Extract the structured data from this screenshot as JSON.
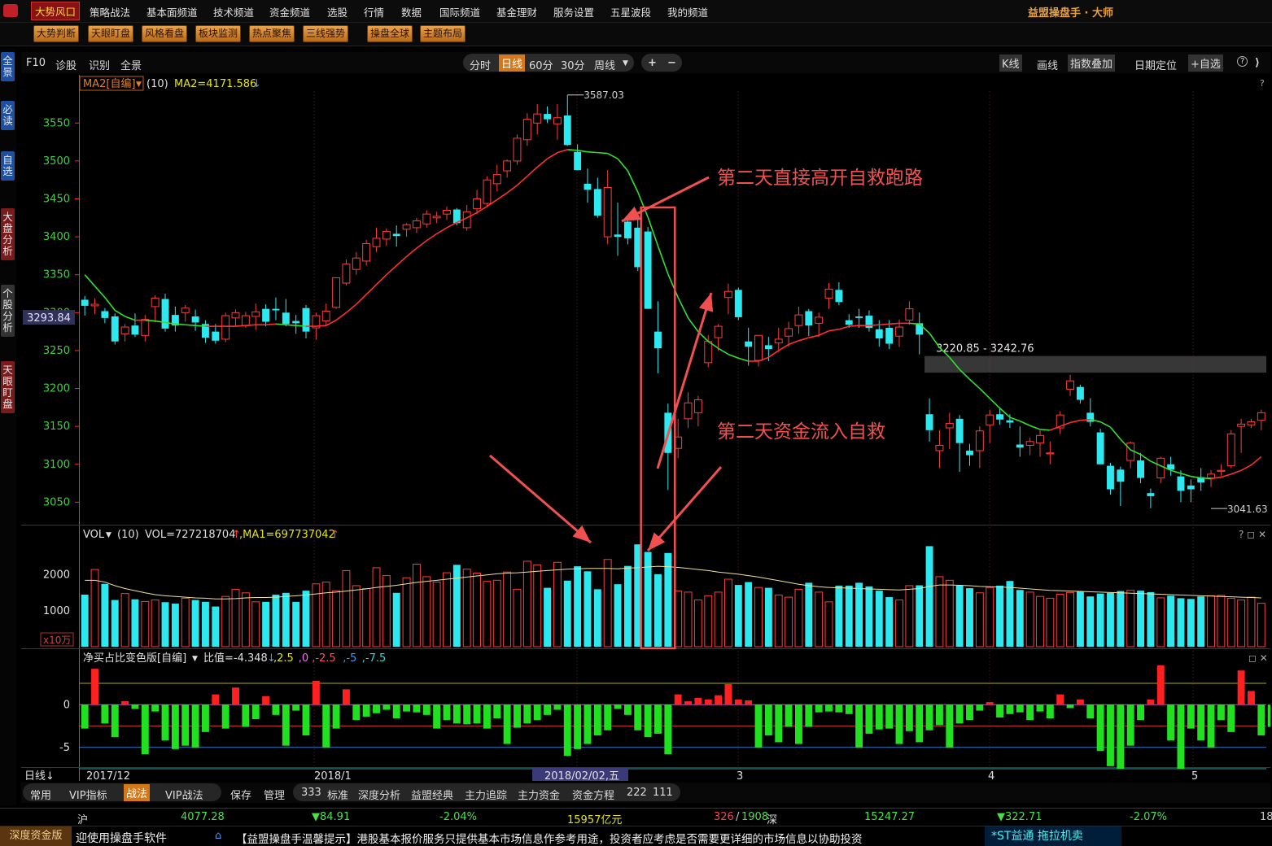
{
  "menu": {
    "items": [
      "大势风口",
      "策略战法",
      "基本面频道",
      "技术频道",
      "资金频道",
      "选股",
      "行情",
      "数据",
      "国际频道",
      "基金理财",
      "服务设置",
      "五星波段",
      "我的频道"
    ],
    "brand": "益盟操盘手 · 大师"
  },
  "buttons_row": [
    "大势判断",
    "天眼盯盘",
    "风格看盘",
    "板块监测",
    "热点聚焦",
    "三线强势",
    "操盘全球",
    "主题布局"
  ],
  "left_tabs": [
    "全景",
    "必读",
    "自选",
    "大盘分析",
    "个股分析",
    "天眼盯盘"
  ],
  "toolbar": {
    "left": [
      "F10",
      "诊股",
      "识别",
      "全景"
    ],
    "periods": [
      "分时",
      "日线",
      "60分",
      "30分",
      "周线"
    ],
    "active_period": "日线",
    "zoom": [
      "+",
      "−"
    ],
    "right": [
      "K线",
      "画线",
      "指数叠加",
      "日期定位",
      "+自选",
      "?"
    ]
  },
  "colors": {
    "up": "#ff3c3c",
    "down": "#2ee8f0",
    "ma_up": "#ff3030",
    "ma_down": "#30e030",
    "annot": "#f05050",
    "axis": "#ff2a2a"
  },
  "chart_data": [
    {
      "type": "candlestick",
      "label": "MA2[自编]",
      "param": "(10)",
      "readout": "MA2=4171.586",
      "current_price_label": "3293.84",
      "ylim": [
        3030,
        3590
      ],
      "yticks": [
        "3550",
        "3500",
        "3450",
        "3400",
        "3350",
        "3300",
        "3250",
        "3200",
        "3150",
        "3100",
        "3050"
      ],
      "xaxis": {
        "period_label": "日线",
        "labels": [
          "2017/12",
          "2018/1",
          "2018/02/02,五",
          "3",
          "4",
          "5"
        ]
      },
      "max_label": "3587.03",
      "min_label": "3041.63",
      "zone_label": "3220.85 - 3242.76",
      "zone": [
        3220.85,
        3242.76
      ],
      "ohlc": [
        [
          3317,
          3322,
          3296,
          3309
        ],
        [
          3309,
          3319,
          3298,
          3311
        ],
        [
          3302,
          3306,
          3286,
          3293
        ],
        [
          3295,
          3299,
          3258,
          3262
        ],
        [
          3272,
          3285,
          3262,
          3281
        ],
        [
          3283,
          3299,
          3268,
          3271
        ],
        [
          3270,
          3297,
          3262,
          3291
        ],
        [
          3308,
          3323,
          3287,
          3319
        ],
        [
          3318,
          3325,
          3275,
          3279
        ],
        [
          3297,
          3308,
          3275,
          3283
        ],
        [
          3300,
          3310,
          3288,
          3306
        ],
        [
          3295,
          3304,
          3276,
          3287
        ],
        [
          3285,
          3290,
          3260,
          3267
        ],
        [
          3275,
          3285,
          3259,
          3263
        ],
        [
          3265,
          3300,
          3261,
          3296
        ],
        [
          3293,
          3304,
          3282,
          3300
        ],
        [
          3283,
          3301,
          3280,
          3296
        ],
        [
          3295,
          3312,
          3277,
          3301
        ],
        [
          3305,
          3311,
          3282,
          3288
        ],
        [
          3305,
          3320,
          3290,
          3303
        ],
        [
          3300,
          3318,
          3282,
          3285
        ],
        [
          3289,
          3297,
          3272,
          3286
        ],
        [
          3306,
          3310,
          3266,
          3275
        ],
        [
          3280,
          3300,
          3264,
          3296
        ],
        [
          3289,
          3312,
          3282,
          3302
        ],
        [
          3307,
          3345,
          3305,
          3346
        ],
        [
          3339,
          3370,
          3336,
          3364
        ],
        [
          3357,
          3380,
          3350,
          3372
        ],
        [
          3368,
          3396,
          3362,
          3391
        ],
        [
          3387,
          3412,
          3380,
          3398
        ],
        [
          3397,
          3411,
          3388,
          3407
        ],
        [
          3404,
          3415,
          3387,
          3401
        ],
        [
          3410,
          3418,
          3400,
          3416
        ],
        [
          3412,
          3425,
          3405,
          3421
        ],
        [
          3417,
          3435,
          3412,
          3430
        ],
        [
          3425,
          3433,
          3418,
          3427
        ],
        [
          3430,
          3440,
          3422,
          3435
        ],
        [
          3436,
          3438,
          3415,
          3418
        ],
        [
          3412,
          3442,
          3408,
          3433
        ],
        [
          3437,
          3462,
          3430,
          3450
        ],
        [
          3444,
          3480,
          3440,
          3475
        ],
        [
          3470,
          3495,
          3460,
          3482
        ],
        [
          3487,
          3502,
          3478,
          3500
        ],
        [
          3500,
          3535,
          3495,
          3530
        ],
        [
          3528,
          3563,
          3520,
          3555
        ],
        [
          3550,
          3575,
          3535,
          3562
        ],
        [
          3562,
          3572,
          3550,
          3555
        ],
        [
          3549,
          3575,
          3528,
          3557
        ],
        [
          3560,
          3587,
          3520,
          3521
        ],
        [
          3512,
          3522,
          3490,
          3488
        ],
        [
          3470,
          3490,
          3445,
          3462
        ],
        [
          3463,
          3478,
          3425,
          3428
        ],
        [
          3400,
          3488,
          3390,
          3465
        ],
        [
          3403,
          3445,
          3375,
          3400
        ],
        [
          3420,
          3423,
          3390,
          3398
        ],
        [
          3412,
          3430,
          3355,
          3360
        ],
        [
          3407,
          3413,
          3305,
          3305
        ],
        [
          3275,
          3315,
          3220,
          3253
        ],
        [
          3168,
          3180,
          3066,
          3115
        ],
        [
          3121,
          3160,
          3108,
          3136
        ],
        [
          3160,
          3195,
          3148,
          3181
        ],
        [
          3168,
          3190,
          3150,
          3185
        ],
        [
          3234,
          3270,
          3228,
          3262
        ],
        [
          3267,
          3285,
          3250,
          3282
        ],
        [
          3320,
          3338,
          3298,
          3328
        ],
        [
          3330,
          3333,
          3290,
          3294
        ],
        [
          3262,
          3280,
          3230,
          3255
        ],
        [
          3237,
          3268,
          3229,
          3270
        ],
        [
          3257,
          3268,
          3236,
          3252
        ],
        [
          3260,
          3280,
          3248,
          3265
        ],
        [
          3269,
          3288,
          3255,
          3279
        ],
        [
          3283,
          3308,
          3272,
          3297
        ],
        [
          3302,
          3305,
          3269,
          3283
        ],
        [
          3286,
          3300,
          3268,
          3294
        ],
        [
          3319,
          3339,
          3305,
          3331
        ],
        [
          3330,
          3340,
          3310,
          3314
        ],
        [
          3290,
          3298,
          3280,
          3284
        ],
        [
          3295,
          3305,
          3280,
          3293
        ],
        [
          3296,
          3303,
          3275,
          3280
        ],
        [
          3278,
          3290,
          3255,
          3266
        ],
        [
          3280,
          3290,
          3252,
          3259
        ],
        [
          3269,
          3291,
          3255,
          3281
        ],
        [
          3290,
          3315,
          3284,
          3305
        ],
        [
          3286,
          3300,
          3245,
          3271
        ],
        [
          3166,
          3187,
          3130,
          3145
        ],
        [
          3118,
          3145,
          3095,
          3125
        ],
        [
          3148,
          3168,
          3120,
          3154
        ],
        [
          3160,
          3165,
          3090,
          3128
        ],
        [
          3118,
          3127,
          3098,
          3112
        ],
        [
          3118,
          3150,
          3095,
          3144
        ],
        [
          3152,
          3172,
          3128,
          3165
        ],
        [
          3166,
          3175,
          3152,
          3159
        ],
        [
          3158,
          3166,
          3148,
          3155
        ],
        [
          3126,
          3150,
          3110,
          3122
        ],
        [
          3125,
          3135,
          3112,
          3130
        ],
        [
          3128,
          3145,
          3110,
          3138
        ],
        [
          3115,
          3130,
          3100,
          3115
        ],
        [
          3148,
          3170,
          3140,
          3165
        ],
        [
          3199,
          3218,
          3190,
          3210
        ],
        [
          3202,
          3205,
          3180,
          3185
        ],
        [
          3168,
          3187,
          3150,
          3156
        ],
        [
          3142,
          3147,
          3105,
          3100
        ],
        [
          3098,
          3102,
          3060,
          3067
        ],
        [
          3093,
          3097,
          3045,
          3077
        ],
        [
          3105,
          3130,
          3095,
          3128
        ],
        [
          3105,
          3115,
          3075,
          3082
        ],
        [
          3062,
          3068,
          3042,
          3058
        ],
        [
          3082,
          3110,
          3075,
          3108
        ],
        [
          3100,
          3110,
          3085,
          3093
        ],
        [
          3084,
          3092,
          3050,
          3065
        ],
        [
          3072,
          3080,
          3050,
          3067
        ],
        [
          3083,
          3095,
          3065,
          3076
        ],
        [
          3082,
          3092,
          3070,
          3087
        ],
        [
          3091,
          3100,
          3085,
          3092
        ],
        [
          3098,
          3145,
          3095,
          3140
        ],
        [
          3150,
          3160,
          3115,
          3153
        ],
        [
          3152,
          3160,
          3148,
          3156
        ],
        [
          3158,
          3172,
          3145,
          3168
        ]
      ],
      "ma": [
        3350,
        3335,
        3320,
        3303,
        3295,
        3290,
        3290,
        3289,
        3287,
        3285,
        3284,
        3283,
        3282,
        3282,
        3282,
        3282,
        3283,
        3284,
        3284,
        3285,
        3284,
        3283,
        3282,
        3282,
        3283,
        3290,
        3300,
        3311,
        3324,
        3337,
        3350,
        3362,
        3374,
        3385,
        3395,
        3404,
        3412,
        3419,
        3425,
        3432,
        3440,
        3449,
        3458,
        3468,
        3480,
        3492,
        3503,
        3511,
        3515,
        3514,
        3512,
        3511,
        3510,
        3503,
        3487,
        3459,
        3426,
        3388,
        3351,
        3320,
        3293,
        3275,
        3262,
        3253,
        3245,
        3240,
        3236,
        3236,
        3241,
        3250,
        3258,
        3263,
        3267,
        3270,
        3276,
        3278,
        3282,
        3283,
        3283,
        3284,
        3285,
        3286,
        3286,
        3285,
        3273,
        3254,
        3241,
        3225,
        3212,
        3200,
        3187,
        3174,
        3162,
        3157,
        3151,
        3146,
        3145,
        3150,
        3155,
        3158,
        3159,
        3156,
        3149,
        3133,
        3119,
        3113,
        3104,
        3098,
        3092,
        3088,
        3084,
        3082,
        3081,
        3083,
        3087,
        3092,
        3099,
        3110
      ]
    },
    {
      "type": "bar",
      "label": "VOL",
      "param": "(10)",
      "readout": "VOL=727218704",
      "ma_readout": "MA1=697737042",
      "ylim": [
        0,
        2900
      ],
      "yticks": [
        "2000",
        "1000"
      ],
      "unit_label": "x10万",
      "values": [
        1450,
        2150,
        1750,
        1300,
        1480,
        1320,
        1260,
        1300,
        1240,
        1200,
        1350,
        1300,
        1250,
        1120,
        1400,
        1600,
        1500,
        1250,
        1250,
        1450,
        1500,
        1250,
        1560,
        1750,
        1800,
        1560,
        2120,
        1700,
        1620,
        2200,
        1980,
        1500,
        1920,
        2300,
        1950,
        1800,
        2060,
        2280,
        2160,
        2050,
        1820,
        1850,
        2080,
        1600,
        2380,
        2280,
        1640,
        2350,
        1840,
        2240,
        2100,
        1600,
        2430,
        1740,
        2250,
        2850,
        2640,
        2020,
        2610,
        1550,
        1520,
        1300,
        1420,
        1520,
        1880,
        1720,
        1800,
        1650,
        1640,
        1440,
        1380,
        1600,
        1780,
        1520,
        1250,
        1700,
        1700,
        1780,
        1680,
        1560,
        1380,
        1300,
        1700,
        1710,
        2800,
        1950,
        1850,
        1700,
        1630,
        1500,
        1650,
        1700,
        1830,
        1580,
        1520,
        1400,
        1350,
        1460,
        1510,
        1540,
        1400,
        1480,
        1500,
        1550,
        1570,
        1560,
        1520,
        1360,
        1420,
        1350,
        1330,
        1400,
        1420,
        1430,
        1350,
        1300,
        1380,
        1210
      ],
      "ma": [
        1850,
        1850,
        1800,
        1700,
        1620,
        1560,
        1500,
        1450,
        1420,
        1400,
        1380,
        1360,
        1350,
        1330,
        1330,
        1340,
        1360,
        1370,
        1370,
        1380,
        1400,
        1420,
        1440,
        1470,
        1500,
        1520,
        1550,
        1580,
        1610,
        1650,
        1680,
        1710,
        1750,
        1790,
        1820,
        1850,
        1880,
        1910,
        1940,
        1970,
        2000,
        2030,
        2050,
        2060,
        2080,
        2100,
        2120,
        2140,
        2160,
        2170,
        2180,
        2180,
        2180,
        2170,
        2190,
        2200,
        2220,
        2240,
        2230,
        2210,
        2180,
        2150,
        2120,
        2080,
        2050,
        2020,
        1980,
        1940,
        1890,
        1840,
        1790,
        1740,
        1700,
        1670,
        1650,
        1640,
        1630,
        1620,
        1610,
        1600,
        1590,
        1580,
        1600,
        1620,
        1680,
        1720,
        1720,
        1710,
        1700,
        1680,
        1670,
        1660,
        1650,
        1630,
        1610,
        1590,
        1570,
        1560,
        1550,
        1540,
        1530,
        1520,
        1510,
        1500,
        1490,
        1480,
        1470,
        1460,
        1450,
        1440,
        1430,
        1420,
        1410,
        1400,
        1390,
        1380,
        1370,
        1360
      ]
    },
    {
      "type": "bar",
      "label": "净买占比变色版[自编]",
      "readout": "比值=-4.348",
      "levels_text": [
        ",2.5",
        ",0",
        ",-2.5",
        ",-5",
        ",-7.5"
      ],
      "level_colors": [
        "#e6e600",
        "#ff66ff",
        "#ff5050",
        "#3a9aff",
        "#30d8d8"
      ],
      "ylim": [
        -7.5,
        4.5
      ],
      "yticks": [
        "0",
        "-5"
      ],
      "values": [
        -2.8,
        4.2,
        -2.2,
        -3.8,
        0.4,
        -0.5,
        -5.8,
        -0.8,
        -4.2,
        -5.2,
        -4.8,
        -5.0,
        -3.2,
        1.2,
        -2.8,
        2.0,
        -2.6,
        -1.7,
        1.0,
        -1.2,
        -4.8,
        -0.7,
        -3.6,
        2.8,
        -5.0,
        -2.8,
        1.8,
        -1.8,
        -1.4,
        -1.0,
        -0.6,
        -1.6,
        -0.8,
        -0.9,
        -1.2,
        -2.8,
        -1.8,
        -2.2,
        -2.3,
        -2.2,
        -2.8,
        -1.6,
        -4.6,
        -2.7,
        -2.2,
        -1.8,
        -1.2,
        -0.6,
        -6.0,
        -5.2,
        -4.6,
        -3.6,
        -3.0,
        -0.5,
        -1.2,
        -3.0,
        -3.8,
        -3.4,
        -5.8,
        1.2,
        0.4,
        0.8,
        0.6,
        1.1,
        2.4,
        0.6,
        0.5,
        -5.0,
        -3.6,
        -4.4,
        -2.6,
        -4.6,
        -2.6,
        -0.9,
        -0.8,
        -0.9,
        -1.1,
        -5.0,
        -3.4,
        -2.9,
        -2.8,
        -4.6,
        -3.1,
        -4.4,
        -3.0,
        -2.4,
        -5.0,
        -2.2,
        -1.8,
        -0.7,
        0.3,
        -1.5,
        -1.1,
        -0.9,
        -1.8,
        -0.8,
        -1.6,
        1.2,
        -0.4,
        0.6,
        -1.6,
        -5.4,
        -7.2,
        -7.5,
        -4.8,
        -1.8,
        0.6,
        4.6,
        -4.2,
        -7.5,
        -2.8,
        -4.2,
        -5.0,
        -1.8,
        -3.2,
        4.0,
        1.6,
        -3.6,
        -2.6
      ]
    }
  ],
  "annotations": [
    "第二天直接高开自救跑路",
    "第二天资金流入自救"
  ],
  "bottom_tabs": [
    "常用",
    "VIP指标",
    "战法",
    "VIP战法",
    "保存",
    "管理",
    "333",
    "标准",
    "深度分析",
    "益盟经典",
    "主力追踪",
    "主力资金",
    "资金方程",
    "222",
    "111"
  ],
  "active_bottom_tab": "战法",
  "status": {
    "sh_label": "沪",
    "sh_price": "4077.28",
    "sh_change": "▼84.91",
    "sh_pct": "-2.04%",
    "sh_amount": "15957亿元",
    "sh_up": "326",
    "sh_sep": "/",
    "sh_down": "1908",
    "sz_label": "深",
    "sz_price": "15247.27",
    "sz_change": "▼322.71",
    "sz_pct": "-2.07%",
    "edge": "18"
  },
  "ticker": {
    "left_label": "深度资金版",
    "message": "迎使用操盘手软件",
    "notice": "【益盟操盘手温馨提示】港股基本报价服务只提供基本市场信息作参考用途，投资者应考虑是否需要更详细的市场信息以协助投资",
    "alert": "*ST益通 拖拉机卖"
  }
}
